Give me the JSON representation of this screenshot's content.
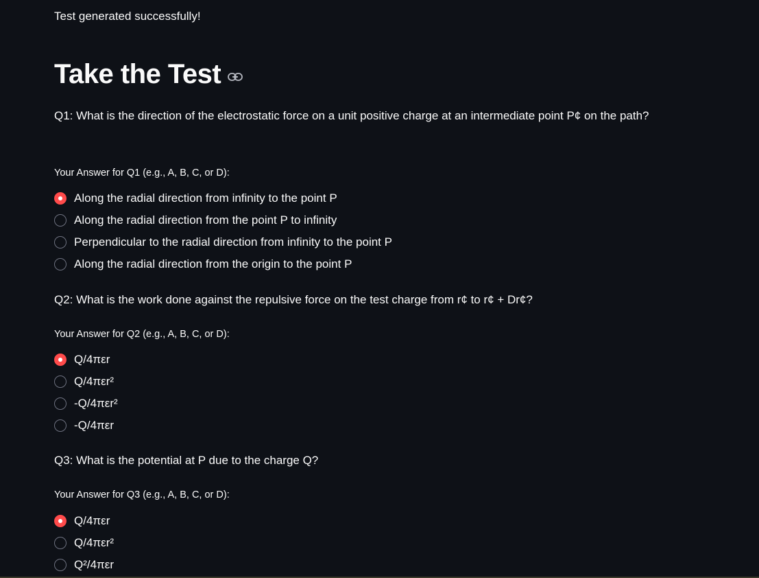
{
  "status": {
    "message": "Test generated successfully!"
  },
  "header": {
    "title": "Take the Test",
    "anchor_icon": "link-icon"
  },
  "colors": {
    "background": "#0e1117",
    "text": "#fafafa",
    "accent": "#ff4b4b",
    "radio_border": "#6e7280"
  },
  "questions": [
    {
      "text": "Q1: What is the direction of the electrostatic force on a unit positive charge at an intermediate point P¢ on the path?",
      "answer_label": "Your Answer for Q1 (e.g., A, B, C, or D):",
      "selected_index": 0,
      "options": [
        "Along the radial direction from infinity to the point P",
        "Along the radial direction from the point P to infinity",
        "Perpendicular to the radial direction from infinity to the point P",
        "Along the radial direction from the origin to the point P"
      ]
    },
    {
      "text": "Q2: What is the work done against the repulsive force on the test charge from r¢ to r¢ + Dr¢?",
      "answer_label": "Your Answer for Q2 (e.g., A, B, C, or D):",
      "selected_index": 0,
      "options": [
        "Q/4πεr",
        "Q/4πεr²",
        "-Q/4πεr²",
        "-Q/4πεr"
      ]
    },
    {
      "text": "Q3: What is the potential at P due to the charge Q?",
      "answer_label": "Your Answer for Q3 (e.g., A, B, C, or D):",
      "selected_index": 0,
      "options": [
        "Q/4πεr",
        "Q/4πεr²",
        "Q²/4πεr"
      ]
    }
  ]
}
